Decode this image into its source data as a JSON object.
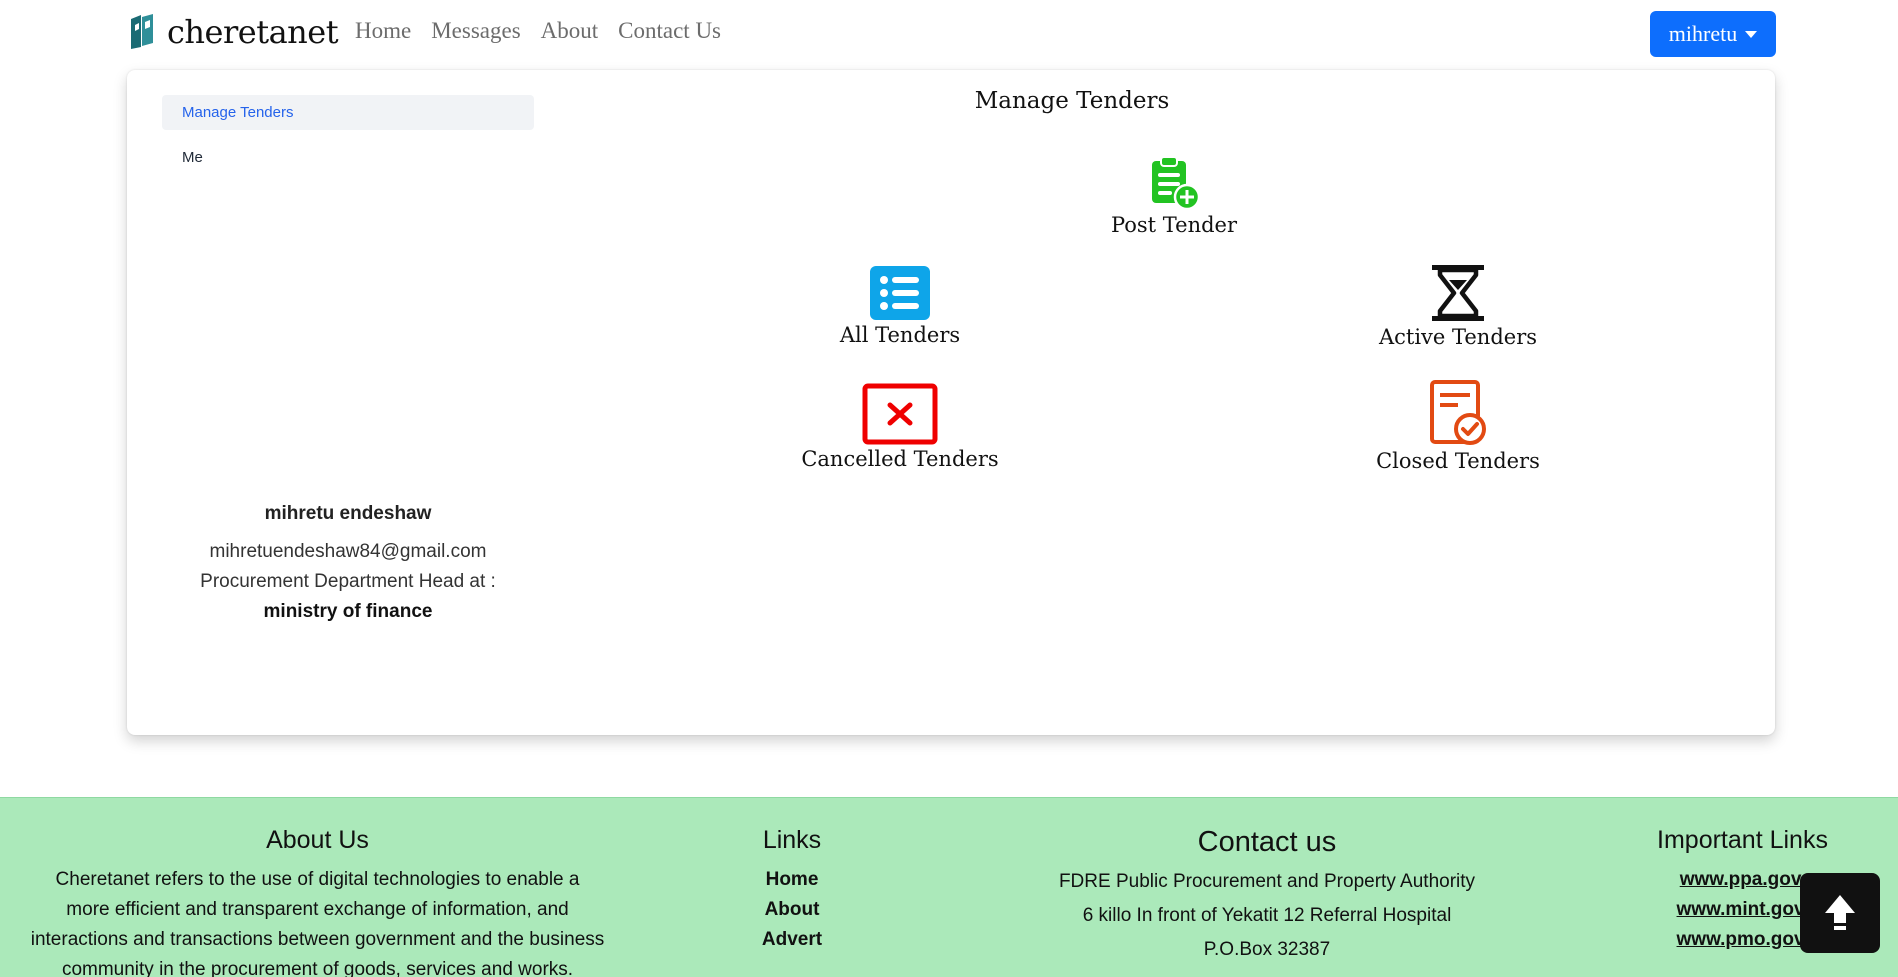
{
  "navbar": {
    "brand": "cheretanet",
    "links": [
      "Home",
      "Messages",
      "About",
      "Contact Us"
    ],
    "user": "mihretu"
  },
  "sidebar": {
    "items": [
      "Manage Tenders",
      "Me"
    ]
  },
  "profile": {
    "name": "mihretu endeshaw",
    "email": "mihretuendeshaw84@gmail.com",
    "role": "Procurement Department Head at :",
    "organization": "ministry of finance"
  },
  "main": {
    "title": "Manage Tenders",
    "tiles": {
      "post": "Post Tender",
      "all": "All Tenders",
      "active": "Active Tenders",
      "cancelled": "Cancelled Tenders",
      "closed": "Closed Tenders"
    }
  },
  "footer": {
    "about": {
      "title": "About Us",
      "text_lines": [
        "Cheretanet refers to the use of digital technologies to enable a",
        "more efficient and transparent exchange of information, and",
        "interactions and transactions between government and the business",
        "community in the procurement of goods, services and works."
      ]
    },
    "links": {
      "title": "Links",
      "items": [
        "Home",
        "About",
        "Advert"
      ]
    },
    "contact": {
      "title": "Contact us",
      "lines": [
        "FDRE Public Procurement and Property Authority",
        "6 killo In front of Yekatit 12 Referral Hospital",
        "P.O.Box 32387"
      ]
    },
    "important": {
      "title": "Important Links",
      "items": [
        "www.ppa.gov.",
        "www.mint.gov.",
        "www.pmo.gov."
      ]
    }
  },
  "colors": {
    "primary": "#0d6efd",
    "post_icon": "#22c322",
    "all_icon": "#0ea5e9",
    "active_icon": "#111111",
    "cancelled_icon": "#ef0000",
    "closed_icon": "#e24a12",
    "footer_bg": "#abe9ba"
  }
}
